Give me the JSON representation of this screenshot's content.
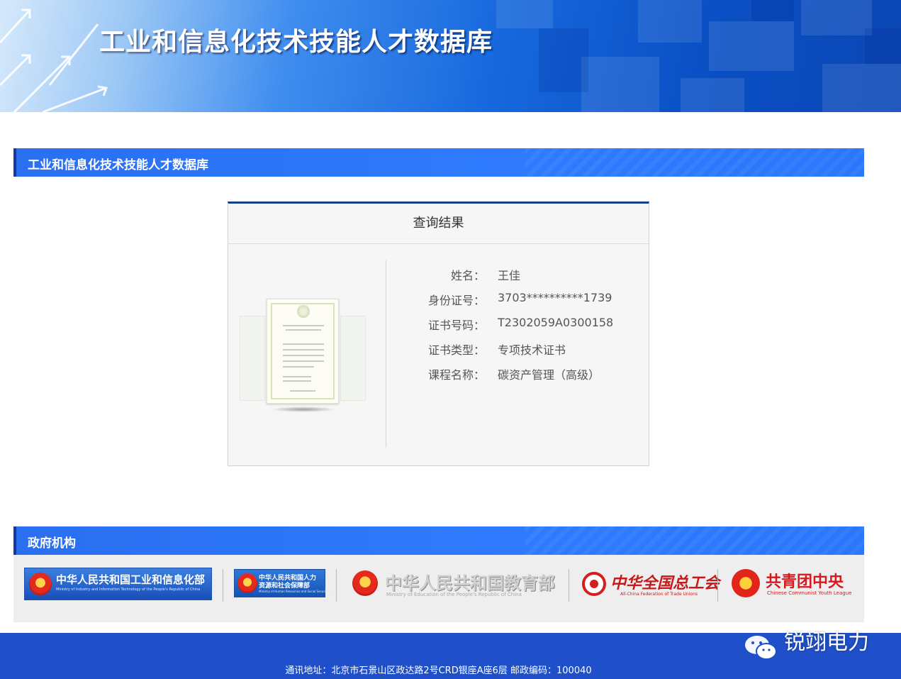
{
  "banner": {
    "title": "工业和信息化技术技能人才数据库"
  },
  "section_main": {
    "title": "工业和信息化技术技能人才数据库"
  },
  "result": {
    "header": "查询结果",
    "rows": [
      {
        "label": "姓名：",
        "value": "王佳"
      },
      {
        "label": "身份证号：",
        "value": "3703**********1739"
      },
      {
        "label": "证书号码：",
        "value": "T2302059A0300158"
      },
      {
        "label": "证书类型：",
        "value": "专项技术证书"
      },
      {
        "label": "课程名称：",
        "value": "碳资产管理（高级）"
      }
    ]
  },
  "gov": {
    "title": "政府机构",
    "agencies": [
      {
        "name": "中华人民共和国工业和信息化部",
        "sub": "Ministry of Industry and Information Technology of the People's Republic of China"
      },
      {
        "name": "中华人民共和国人力资源和社会保障部",
        "line1": "中华人民共和国人力",
        "line2": "资源和社会保障部",
        "sub": "Ministry of Human Resources and Social Security PRC"
      },
      {
        "name": "中华人民共和国教育部",
        "sub": "Ministry of Education of the People's Republic of China"
      },
      {
        "name": "中华全国总工会",
        "sub": "All-China Federation of Trade Unions"
      },
      {
        "name": "共青团中央",
        "sub": "Chinese Communist Youth League"
      }
    ]
  },
  "footer": {
    "address": "通讯地址：北京市石景山区政达路2号CRD银座A座6层 邮政编码：100040"
  },
  "watermark": {
    "text": "锐翊电力"
  },
  "colors": {
    "section_blue": "#2f7bff",
    "footer_blue": "#1f4fc9",
    "card_top": "#123f8c"
  }
}
